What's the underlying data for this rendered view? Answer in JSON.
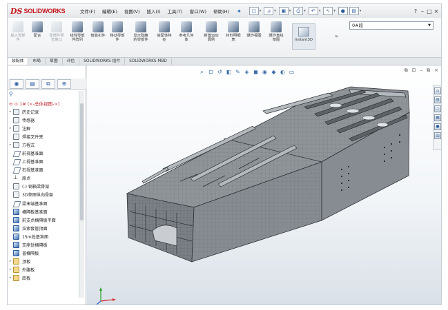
{
  "app": {
    "logo_ds": "DS",
    "logo_name": "SOLIDWORKS"
  },
  "menu": [
    "文件(F)",
    "编辑(E)",
    "视图(V)",
    "插入(I)",
    "工具(T)",
    "窗口(W)",
    "帮助(H)"
  ],
  "quick_access": [
    "new-icon",
    "open-icon",
    "save-icon",
    "print-icon",
    "undo-icon",
    "select-icon",
    "rebuild-icon",
    "options-icon"
  ],
  "window_controls": [
    "?",
    "–",
    "□",
    "×"
  ],
  "ribbon": {
    "buttons": [
      {
        "label": "插入零部件",
        "icon": "insert-component-icon",
        "enabled": true
      },
      {
        "label": "配合",
        "icon": "mate-icon",
        "enabled": true
      },
      {
        "label": "零部件预览窗口",
        "icon": "preview-window-icon",
        "enabled": false
      },
      {
        "label": "线性零部件阵列",
        "icon": "linear-pattern-icon",
        "enabled": true
      },
      {
        "label": "智能扣件",
        "icon": "smart-fastener-icon",
        "enabled": true
      },
      {
        "label": "移动零部件",
        "icon": "move-component-icon",
        "enabled": true
      },
      {
        "label": "显示隐藏的零部件",
        "icon": "show-hidden-icon",
        "enabled": true
      },
      {
        "label": "装配体特征",
        "icon": "assembly-feature-icon",
        "enabled": true
      },
      {
        "label": "参考几何体",
        "icon": "reference-geometry-icon",
        "enabled": true
      },
      {
        "label": "新建运动算例",
        "icon": "motion-study-icon",
        "enabled": true
      },
      {
        "label": "材料明细表",
        "icon": "bom-icon",
        "enabled": true
      },
      {
        "label": "爆炸视图",
        "icon": "exploded-view-icon",
        "enabled": true
      },
      {
        "label": "爆炸直线草图",
        "icon": "explode-line-sketch-icon",
        "enabled": true
      }
    ],
    "instant3d": "Instant3D",
    "more": "»",
    "configuration": "0#段"
  },
  "command_tabs": [
    {
      "label": "装配体",
      "active": true
    },
    {
      "label": "布局",
      "active": false
    },
    {
      "label": "草图",
      "active": false
    },
    {
      "label": "评估",
      "active": false
    },
    {
      "label": "SOLIDWORKS 插件",
      "active": false
    },
    {
      "label": "SOLIDWORKS MBD",
      "active": false
    }
  ],
  "feature_manager": {
    "tabs": [
      "feature-tree-icon",
      "property-manager-icon",
      "configuration-manager-icon",
      "dim-expert-icon"
    ],
    "root": "1# (<-总体视图->)",
    "items": [
      {
        "label": "历史记录",
        "icon": "folder",
        "expand": "▸"
      },
      {
        "label": "传感器",
        "icon": "folder",
        "expand": ""
      },
      {
        "label": "注解",
        "icon": "folder",
        "expand": "▸"
      },
      {
        "label": "焊接文件夹",
        "icon": "folder",
        "expand": ""
      },
      {
        "label": "方程式",
        "icon": "folder",
        "expand": "▸"
      },
      {
        "label": "前视基准面",
        "icon": "plane",
        "expand": ""
      },
      {
        "label": "上视基准面",
        "icon": "plane",
        "expand": ""
      },
      {
        "label": "右视基准面",
        "icon": "plane",
        "expand": ""
      },
      {
        "label": "原点",
        "icon": "origin",
        "expand": ""
      },
      {
        "label": "(-) 钢箱梁骨架",
        "icon": "sk",
        "expand": ""
      },
      {
        "label": "3D草图纵向骨架",
        "icon": "sk",
        "expand": ""
      },
      {
        "label": "梁末端基准面",
        "icon": "plane",
        "expand": ""
      },
      {
        "label": "横隔板基准面",
        "icon": "sk",
        "expand": ""
      },
      {
        "label": "前支点横隔板平面",
        "icon": "sk",
        "expand": ""
      },
      {
        "label": "拉索套管顶面",
        "icon": "sk",
        "expand": ""
      },
      {
        "label": "15m处基准面",
        "icon": "sk",
        "expand": ""
      },
      {
        "label": "支座处横隔板",
        "icon": "sk",
        "expand": ""
      },
      {
        "label": "普横隔板",
        "icon": "sk",
        "expand": ""
      },
      {
        "label": "顶板",
        "icon": "folder",
        "expand": "▸"
      },
      {
        "label": "外腹板",
        "icon": "folder",
        "expand": "▸"
      },
      {
        "label": "底板",
        "icon": "folder",
        "expand": "▸"
      }
    ]
  },
  "viewport": {
    "heads_up": [
      "zoom-fit-icon",
      "zoom-area-icon",
      "previous-view-icon",
      "section-view-icon",
      "dynamic-annotation-icon",
      "view-orientation-icon",
      "display-style-icon",
      "hide-show-icon",
      "edit-appearance-icon",
      "scene-icon",
      "view-settings-icon"
    ],
    "controls": [
      "⧉",
      "⊡",
      "–",
      "⧉",
      "×"
    ],
    "task_pane": [
      "⌂",
      "▤",
      "▢",
      "▦",
      "●",
      "▥"
    ]
  },
  "colors": {
    "brand": "#c4161c",
    "ribbon_bg": "#eef0f2",
    "model_top": "#8b9095",
    "model_side": "#6c7176",
    "model_lines": "#2d3034"
  }
}
